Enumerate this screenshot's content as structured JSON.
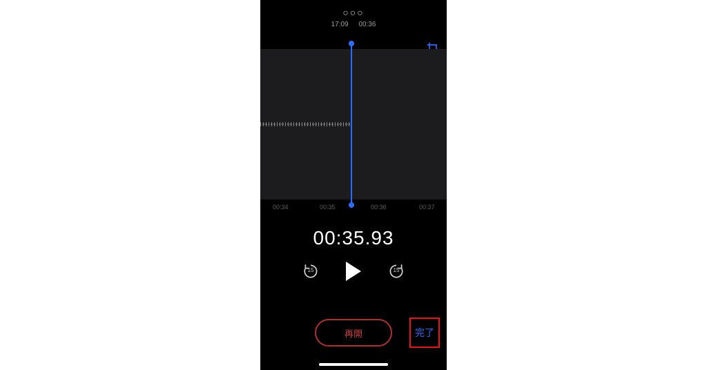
{
  "header": {
    "dots_glyph": "○○○",
    "clock": "17:09",
    "duration": "00:36"
  },
  "icons": {
    "crop": "crop-icon",
    "rewind": "skip-back-15-icon",
    "forward": "skip-forward-15-icon",
    "play": "play-icon"
  },
  "timeline": {
    "ticks": [
      "00:34",
      "00:35",
      "00:36",
      "00:37"
    ]
  },
  "playback": {
    "current_time": "00:35.93",
    "skip_seconds": "15"
  },
  "buttons": {
    "resume": "再開",
    "done": "完了"
  },
  "colors": {
    "accent": "#2b6cff",
    "record": "#cf3a37",
    "highlight_box": "#e11"
  }
}
